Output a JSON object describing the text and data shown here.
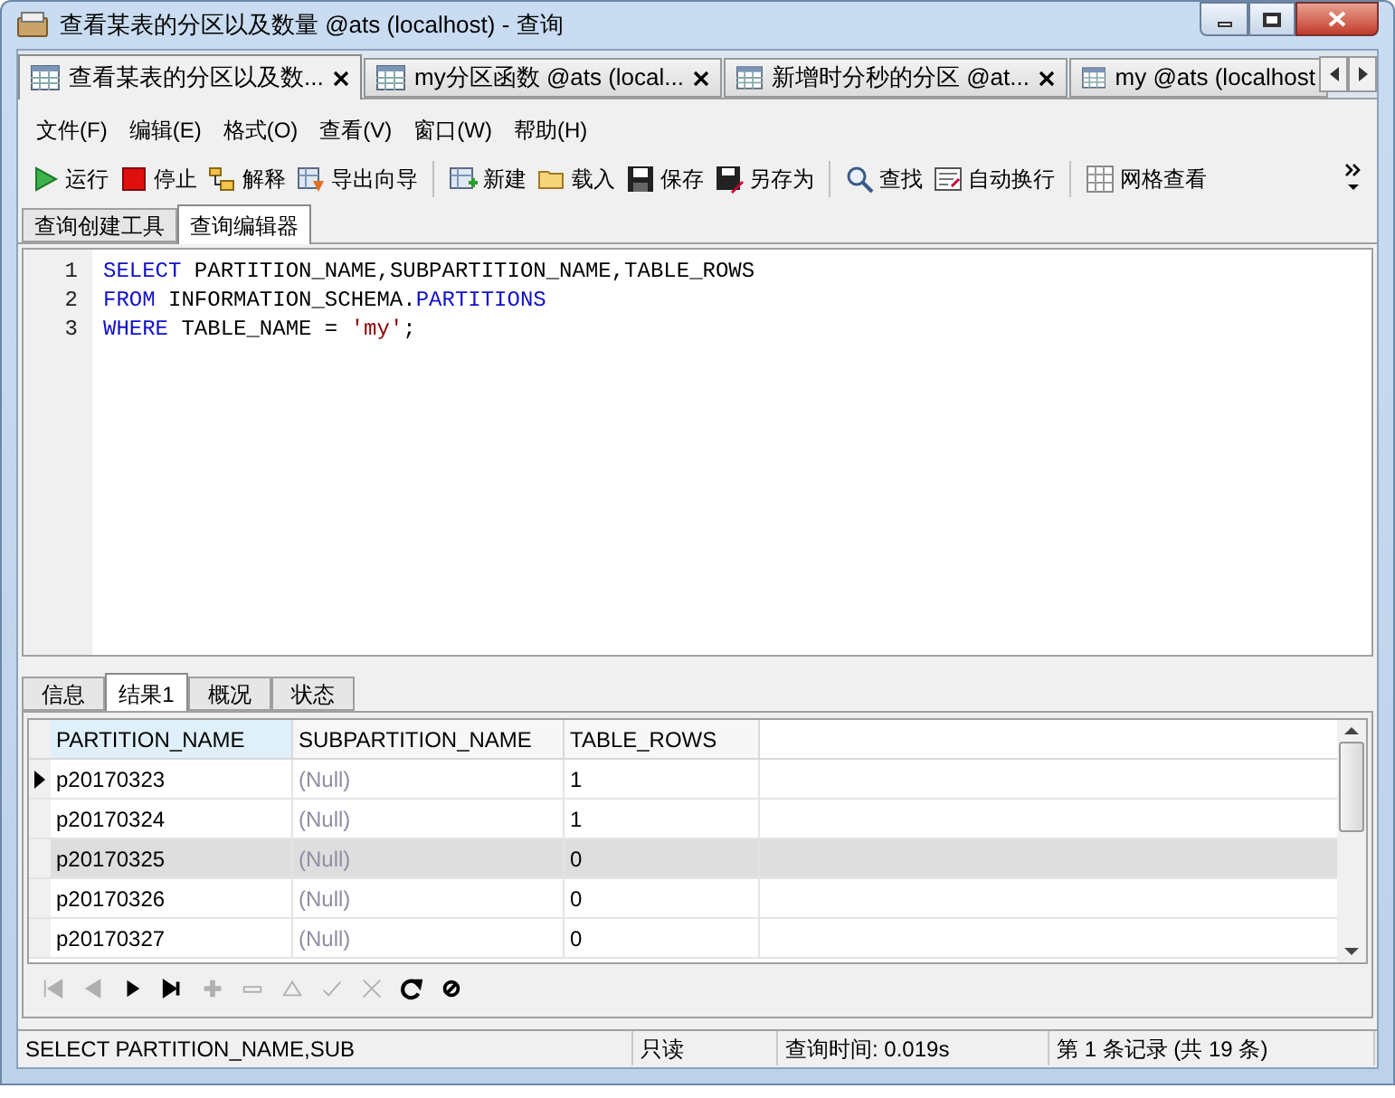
{
  "window": {
    "title": "查看某表的分区以及数量 @ats (localhost) - 查询"
  },
  "doc_tabs": [
    {
      "label": "查看某表的分区以及数...",
      "selected": true,
      "closable": true
    },
    {
      "label": "my分区函数 @ats (local...",
      "selected": false,
      "closable": true
    },
    {
      "label": "新增时分秒的分区 @at...",
      "selected": false,
      "closable": true
    },
    {
      "label": "my @ats (localhost",
      "selected": false,
      "closable": false
    }
  ],
  "menu": [
    "文件(F)",
    "编辑(E)",
    "格式(O)",
    "查看(V)",
    "窗口(W)",
    "帮助(H)"
  ],
  "toolbar": [
    [
      {
        "kind": "run",
        "label": "运行"
      },
      {
        "kind": "stop",
        "label": "停止"
      },
      {
        "kind": "explain",
        "label": "解释"
      },
      {
        "kind": "export",
        "label": "导出向导"
      }
    ],
    [
      {
        "kind": "new",
        "label": "新建"
      },
      {
        "kind": "load",
        "label": "载入"
      },
      {
        "kind": "save",
        "label": "保存"
      },
      {
        "kind": "saveas",
        "label": "另存为"
      }
    ],
    [
      {
        "kind": "find",
        "label": "查找"
      },
      {
        "kind": "wrap",
        "label": "自动换行"
      }
    ],
    [
      {
        "kind": "grid",
        "label": "网格查看"
      }
    ]
  ],
  "sub_tabs": [
    {
      "label": "查询创建工具",
      "selected": false
    },
    {
      "label": "查询编辑器",
      "selected": true
    }
  ],
  "editor": {
    "lines": [
      {
        "number": "1",
        "tokens": [
          {
            "kind": "keyword",
            "text": "SELECT"
          },
          {
            "kind": "plain",
            "text": " PARTITION_NAME,SUBPARTITION_NAME,TABLE_ROWS"
          }
        ]
      },
      {
        "number": "2",
        "tokens": [
          {
            "kind": "keyword",
            "text": "FROM"
          },
          {
            "kind": "plain",
            "text": " INFORMATION_SCHEMA."
          },
          {
            "kind": "table",
            "text": "PARTITIONS"
          }
        ]
      },
      {
        "number": "3",
        "tokens": [
          {
            "kind": "keyword",
            "text": "WHERE"
          },
          {
            "kind": "plain",
            "text": " TABLE_NAME = "
          },
          {
            "kind": "string",
            "text": "'my'"
          },
          {
            "kind": "plain",
            "text": ";"
          }
        ]
      }
    ]
  },
  "result_tabs": [
    {
      "label": "信息",
      "selected": false
    },
    {
      "label": "结果1",
      "selected": true
    },
    {
      "label": "概况",
      "selected": false
    },
    {
      "label": "状态",
      "selected": false
    }
  ],
  "table": {
    "columns": [
      "PARTITION_NAME",
      "SUBPARTITION_NAME",
      "TABLE_ROWS"
    ],
    "rows": [
      {
        "cells": [
          "p20170323",
          "(Null)",
          "1"
        ],
        "current": true,
        "selected": false
      },
      {
        "cells": [
          "p20170324",
          "(Null)",
          "1"
        ],
        "current": false,
        "selected": false
      },
      {
        "cells": [
          "p20170325",
          "(Null)",
          "0"
        ],
        "current": false,
        "selected": true
      },
      {
        "cells": [
          "p20170326",
          "(Null)",
          "0"
        ],
        "current": false,
        "selected": false
      },
      {
        "cells": [
          "p20170327",
          "(Null)",
          "0"
        ],
        "current": false,
        "selected": false
      }
    ]
  },
  "nav_buttons": [
    {
      "kind": "first",
      "disabled": true
    },
    {
      "kind": "prev",
      "disabled": true
    },
    {
      "kind": "next",
      "disabled": false
    },
    {
      "kind": "last",
      "disabled": false
    },
    {
      "kind": "add",
      "disabled": true
    },
    {
      "kind": "delete",
      "disabled": true
    },
    {
      "kind": "apply",
      "disabled": true
    },
    {
      "kind": "check",
      "disabled": true
    },
    {
      "kind": "cancel",
      "disabled": true
    },
    {
      "kind": "refresh",
      "disabled": false
    },
    {
      "kind": "abort",
      "disabled": false
    }
  ],
  "status_bar": [
    "SELECT PARTITION_NAME,SUB",
    "只读",
    "查询时间: 0.019s",
    "第 1 条记录 (共 19 条)"
  ]
}
